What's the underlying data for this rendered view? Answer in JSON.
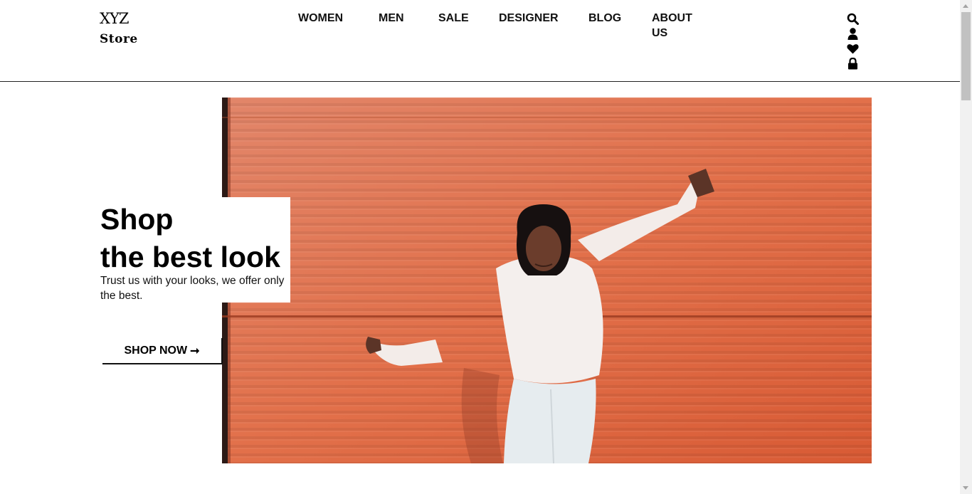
{
  "brand": {
    "line1": "XYZ",
    "line2": "Store"
  },
  "nav": {
    "women": "WOMEN",
    "men": "MEN",
    "sale": "SALE",
    "designer": "DESIGNER",
    "blog": "BLOG",
    "about": "ABOUT US"
  },
  "icons": [
    "search-icon",
    "user-icon",
    "heart-icon",
    "bag-lock-icon"
  ],
  "hero": {
    "title_line1": "Shop",
    "title_line2": "the best look",
    "subtitle": "Trust us with your looks, we offer only the best.",
    "cta": "SHOP NOW",
    "cta_arrow": "➞"
  },
  "colors": {
    "hero_wall": "#e07350",
    "text": "#000000"
  }
}
